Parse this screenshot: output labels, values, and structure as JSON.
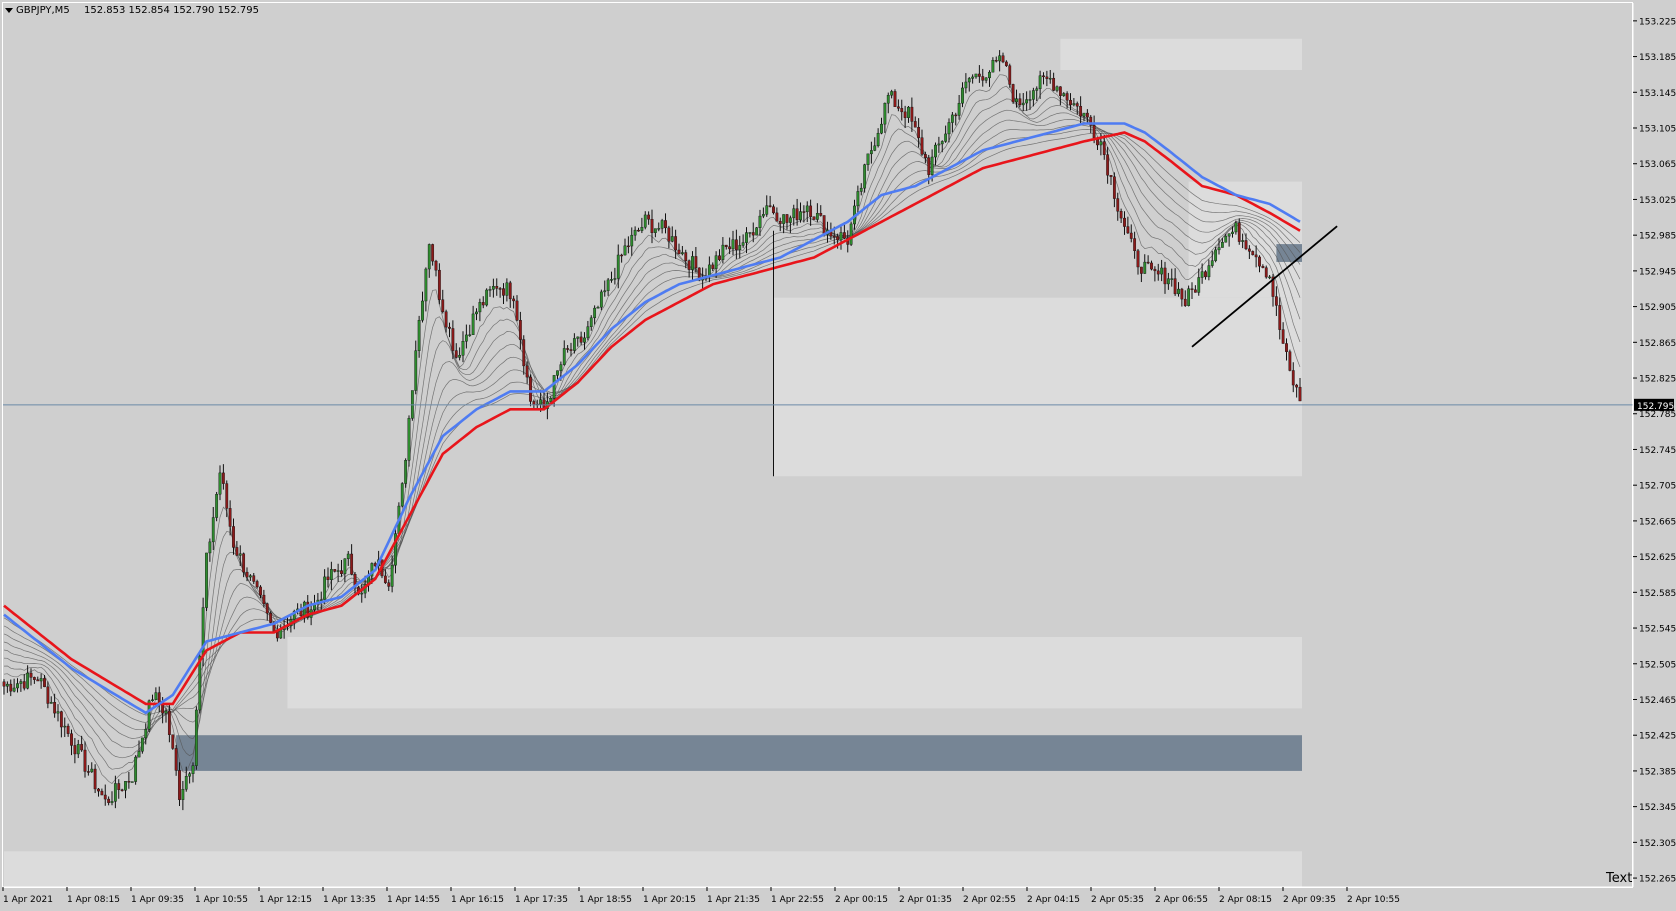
{
  "header": {
    "symbol_label": "GBPJPY,M5",
    "ohlc_label": "152.853 152.854 152.790 152.795"
  },
  "corner_text": "Text",
  "colors": {
    "background": "#cfcfcf",
    "zone_light": "#dcdcdc",
    "zone_dark": "#768595",
    "ma_red": "#e8151b",
    "ma_blue": "#4f7cf2",
    "ribbon": "#555555",
    "bull_body": "#2e8b2e",
    "bear_body": "#8b1a1a",
    "current_price_line": "#6b8aa8"
  },
  "chart_data": {
    "type": "candlestick",
    "symbol": "GBPJPY",
    "timeframe": "M5",
    "ylim": [
      152.255,
      153.245
    ],
    "y_ticks": [
      "153.225",
      "153.185",
      "153.145",
      "153.105",
      "153.065",
      "153.025",
      "152.985",
      "152.945",
      "152.905",
      "152.865",
      "152.825",
      "152.785",
      "152.745",
      "152.705",
      "152.665",
      "152.625",
      "152.585",
      "152.545",
      "152.505",
      "152.465",
      "152.425",
      "152.385",
      "152.345",
      "152.305",
      "152.265"
    ],
    "x_ticks": [
      "1 Apr 2021",
      "1 Apr 08:15",
      "1 Apr 09:35",
      "1 Apr 10:55",
      "1 Apr 12:15",
      "1 Apr 13:35",
      "1 Apr 14:55",
      "1 Apr 16:15",
      "1 Apr 17:35",
      "1 Apr 18:55",
      "1 Apr 20:15",
      "1 Apr 21:35",
      "1 Apr 22:55",
      "2 Apr 00:15",
      "2 Apr 01:35",
      "2 Apr 02:55",
      "2 Apr 04:15",
      "2 Apr 05:35",
      "2 Apr 06:55",
      "2 Apr 08:15",
      "2 Apr 09:35",
      "2 Apr 10:55"
    ],
    "current_price": 152.795,
    "current_price_label": "152.795",
    "close_path": [
      [
        0,
        152.48
      ],
      [
        10,
        152.49
      ],
      [
        20,
        152.42
      ],
      [
        30,
        152.35
      ],
      [
        38,
        152.38
      ],
      [
        44,
        152.47
      ],
      [
        48,
        152.45
      ],
      [
        52,
        152.36
      ],
      [
        56,
        152.4
      ],
      [
        60,
        152.62
      ],
      [
        64,
        152.72
      ],
      [
        68,
        152.64
      ],
      [
        74,
        152.59
      ],
      [
        80,
        152.54
      ],
      [
        86,
        152.56
      ],
      [
        92,
        152.57
      ],
      [
        96,
        152.6
      ],
      [
        102,
        152.62
      ],
      [
        106,
        152.58
      ],
      [
        110,
        152.62
      ],
      [
        114,
        152.6
      ],
      [
        118,
        152.7
      ],
      [
        122,
        152.86
      ],
      [
        126,
        152.98
      ],
      [
        129,
        152.92
      ],
      [
        134,
        152.85
      ],
      [
        140,
        152.9
      ],
      [
        146,
        152.93
      ],
      [
        151,
        152.92
      ],
      [
        156,
        152.8
      ],
      [
        160,
        152.79
      ],
      [
        166,
        152.85
      ],
      [
        172,
        152.87
      ],
      [
        178,
        152.92
      ],
      [
        184,
        152.97
      ],
      [
        190,
        153.0
      ],
      [
        196,
        152.99
      ],
      [
        202,
        152.96
      ],
      [
        207,
        152.94
      ],
      [
        214,
        152.97
      ],
      [
        220,
        152.98
      ],
      [
        226,
        153.02
      ],
      [
        232,
        153.0
      ],
      [
        238,
        153.02
      ],
      [
        244,
        152.99
      ],
      [
        250,
        152.98
      ],
      [
        256,
        153.07
      ],
      [
        262,
        153.14
      ],
      [
        268,
        153.12
      ],
      [
        274,
        153.06
      ],
      [
        280,
        153.11
      ],
      [
        286,
        153.16
      ],
      [
        292,
        153.17
      ],
      [
        296,
        153.18
      ],
      [
        300,
        153.13
      ],
      [
        305,
        153.15
      ],
      [
        310,
        153.16
      ],
      [
        315,
        153.14
      ],
      [
        320,
        153.12
      ],
      [
        325,
        153.09
      ],
      [
        330,
        153.02
      ],
      [
        335,
        152.96
      ],
      [
        340,
        152.94
      ],
      [
        345,
        152.94
      ],
      [
        350,
        152.91
      ],
      [
        355,
        152.94
      ],
      [
        360,
        152.98
      ],
      [
        365,
        152.99
      ],
      [
        370,
        152.97
      ],
      [
        375,
        152.94
      ],
      [
        378,
        152.88
      ],
      [
        381,
        152.83
      ],
      [
        384,
        152.8
      ]
    ],
    "moving_averages": [
      {
        "color": "#e8151b",
        "points": [
          [
            0,
            152.57
          ],
          [
            20,
            152.51
          ],
          [
            42,
            152.46
          ],
          [
            50,
            152.46
          ],
          [
            60,
            152.52
          ],
          [
            70,
            152.54
          ],
          [
            80,
            152.54
          ],
          [
            90,
            152.56
          ],
          [
            100,
            152.57
          ],
          [
            110,
            152.6
          ],
          [
            120,
            152.67
          ],
          [
            130,
            152.74
          ],
          [
            140,
            152.77
          ],
          [
            150,
            152.79
          ],
          [
            160,
            152.79
          ],
          [
            170,
            152.82
          ],
          [
            180,
            152.86
          ],
          [
            190,
            152.89
          ],
          [
            200,
            152.91
          ],
          [
            210,
            152.93
          ],
          [
            220,
            152.94
          ],
          [
            230,
            152.95
          ],
          [
            240,
            152.96
          ],
          [
            250,
            152.98
          ],
          [
            260,
            153.0
          ],
          [
            270,
            153.02
          ],
          [
            280,
            153.04
          ],
          [
            290,
            153.06
          ],
          [
            300,
            153.07
          ],
          [
            310,
            153.08
          ],
          [
            320,
            153.09
          ],
          [
            332,
            153.1
          ],
          [
            338,
            153.09
          ],
          [
            345,
            153.07
          ],
          [
            355,
            153.04
          ],
          [
            365,
            153.03
          ],
          [
            375,
            153.01
          ],
          [
            384,
            152.99
          ]
        ]
      },
      {
        "color": "#4f7cf2",
        "points": [
          [
            0,
            152.56
          ],
          [
            20,
            152.5
          ],
          [
            42,
            152.45
          ],
          [
            50,
            152.47
          ],
          [
            60,
            152.53
          ],
          [
            70,
            152.54
          ],
          [
            80,
            152.55
          ],
          [
            90,
            152.57
          ],
          [
            100,
            152.58
          ],
          [
            110,
            152.61
          ],
          [
            120,
            152.69
          ],
          [
            130,
            152.76
          ],
          [
            140,
            152.79
          ],
          [
            150,
            152.81
          ],
          [
            160,
            152.81
          ],
          [
            170,
            152.84
          ],
          [
            180,
            152.88
          ],
          [
            190,
            152.91
          ],
          [
            200,
            152.93
          ],
          [
            210,
            152.94
          ],
          [
            220,
            152.95
          ],
          [
            230,
            152.96
          ],
          [
            240,
            152.98
          ],
          [
            250,
            153.0
          ],
          [
            260,
            153.03
          ],
          [
            270,
            153.04
          ],
          [
            280,
            153.06
          ],
          [
            290,
            153.08
          ],
          [
            300,
            153.09
          ],
          [
            310,
            153.1
          ],
          [
            320,
            153.11
          ],
          [
            332,
            153.11
          ],
          [
            338,
            153.1
          ],
          [
            345,
            153.08
          ],
          [
            355,
            153.05
          ],
          [
            365,
            153.03
          ],
          [
            375,
            153.02
          ],
          [
            384,
            153.0
          ]
        ]
      }
    ],
    "zones": [
      {
        "from_bar": 0,
        "to_bar": 384,
        "top": 152.295,
        "bottom": 152.255,
        "shade": "light"
      },
      {
        "from_bar": 84,
        "to_bar": 384,
        "top": 152.535,
        "bottom": 152.455,
        "shade": "light"
      },
      {
        "from_bar": 51,
        "to_bar": 384,
        "top": 152.425,
        "bottom": 152.385,
        "shade": "dark"
      },
      {
        "from_bar": 228,
        "to_bar": 384,
        "top": 152.915,
        "bottom": 152.715,
        "shade": "light"
      },
      {
        "from_bar": 313,
        "to_bar": 384,
        "top": 153.205,
        "bottom": 153.17,
        "shade": "light"
      },
      {
        "from_bar": 351,
        "to_bar": 384,
        "top": 153.045,
        "bottom": 152.915,
        "shade": "light"
      },
      {
        "from_bar": 377,
        "to_bar": 384,
        "top": 152.975,
        "bottom": 152.955,
        "shade": "dark"
      }
    ],
    "trendline": {
      "from": [
        352,
        152.86
      ],
      "to": [
        395,
        152.995
      ]
    },
    "vertical_line_bar": 228,
    "vertical_line_range": [
      152.715,
      152.99
    ],
    "bars_total": 385,
    "grid": false
  }
}
